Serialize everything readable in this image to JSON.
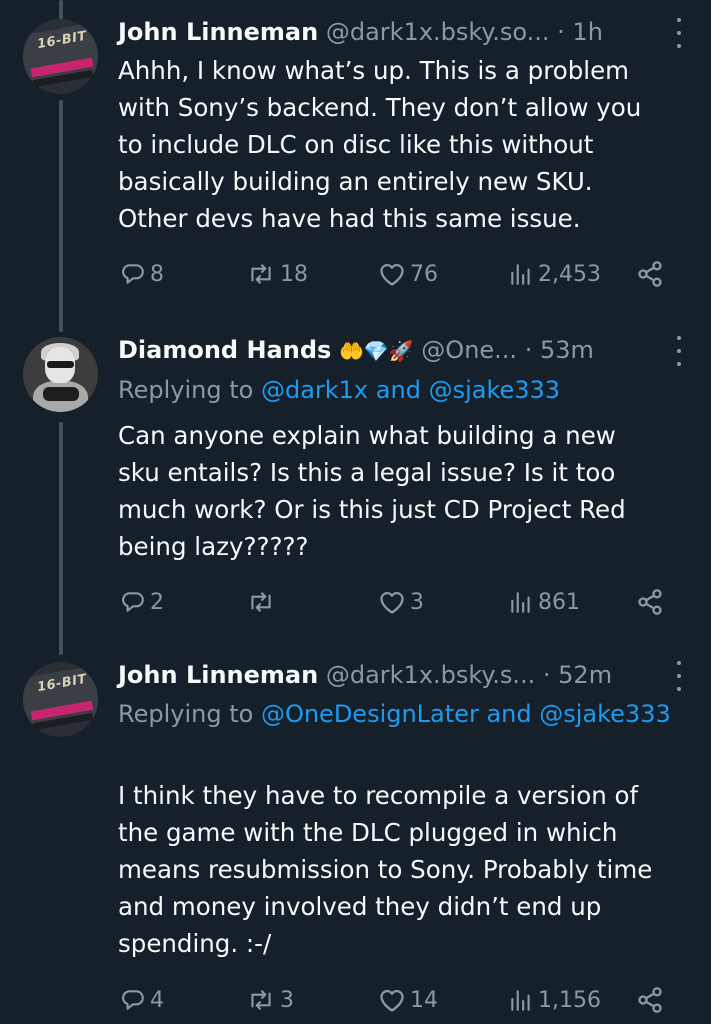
{
  "tweets": [
    {
      "avatar_icon": "16-bit-cartridge-avatar",
      "avatar_text": "16-BIT",
      "name": "John Linneman",
      "handle": "@dark1x.bsky.so...",
      "separator": "·",
      "time": "1h",
      "body": "Ahhh, I know what’s up. This is a problem\nwith Sony’s backend. They don’t allow you\nto include DLC on disc like this without\nbasically building an entirely new SKU.\nOther devs have had this same issue.",
      "replies": "8",
      "reposts": "18",
      "likes": "76",
      "views": "2,453"
    },
    {
      "avatar_icon": "statue-avatar",
      "name": "Diamond Hands",
      "emojis": "🤲💎🚀",
      "handle": "@One...",
      "separator": "·",
      "time": "53m",
      "replying_prefix": "Replying to",
      "mention1": "@dark1x",
      "and_word": "and",
      "mention2": "@sjake333",
      "body": "Can anyone explain what building a new\nsku entails? Is this a legal issue? Is it too\nmuch work? Or is this just CD Project Red\nbeing lazy?????",
      "replies": "2",
      "reposts": "",
      "likes": "3",
      "views": "861"
    },
    {
      "avatar_icon": "16-bit-cartridge-avatar",
      "avatar_text": "16-BIT",
      "name": "John Linneman",
      "handle": "@dark1x.bsky.s...",
      "separator": "·",
      "time": "52m",
      "replying_prefix": "Replying to",
      "mention1": "@OneDesignLater",
      "and_word": "and",
      "mention2": "@sjake333",
      "body": "I think they have to recompile a version of\nthe game with the DLC plugged in which\nmeans resubmission to Sony. Probably time\nand money involved they didn’t end up\nspending. :-/",
      "replies": "4",
      "reposts": "3",
      "likes": "14",
      "views": "1,156"
    }
  ],
  "colors": {
    "background": "#15202b",
    "text": "#f7f9f9",
    "muted": "#8b98a5",
    "link": "#1d9bf0",
    "thread_line": "#42535f"
  }
}
